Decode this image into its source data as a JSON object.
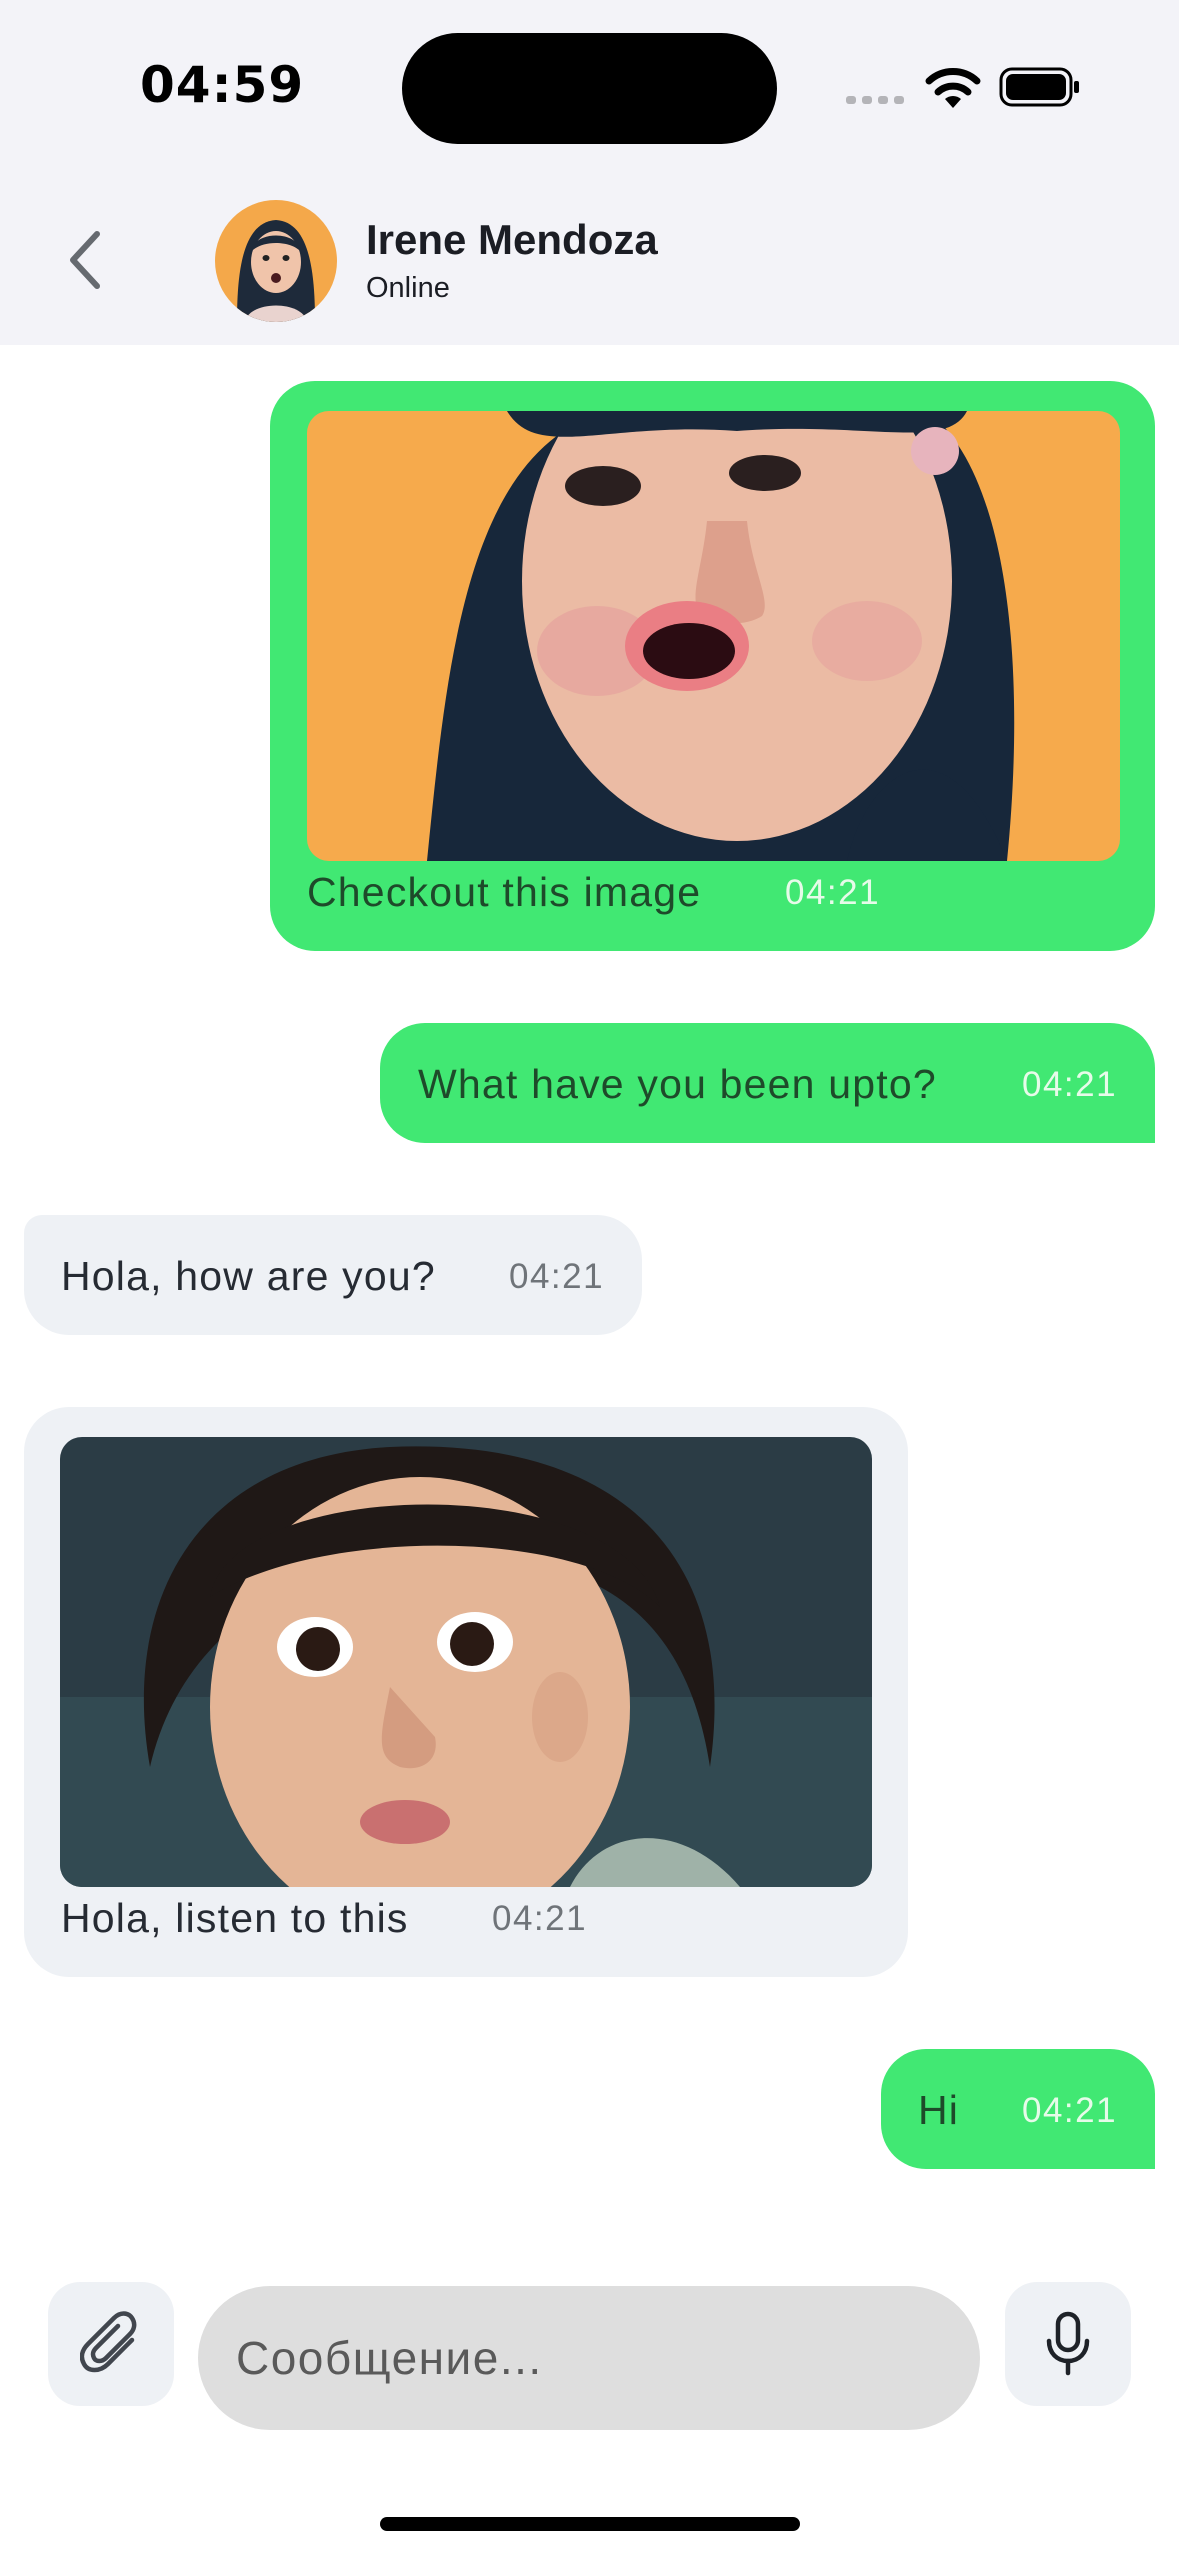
{
  "status_bar": {
    "time": "04:59"
  },
  "header": {
    "contact_name": "Irene Mendoza",
    "contact_status": "Online",
    "avatar": "girl-portrait"
  },
  "messages": [
    {
      "direction": "outgoing",
      "type": "image",
      "image": "girl-surprised-photo",
      "text": "Checkout this image",
      "time": "04:21"
    },
    {
      "direction": "outgoing",
      "type": "text",
      "text": "What have you been upto?",
      "time": "04:21"
    },
    {
      "direction": "incoming",
      "type": "text",
      "text": "Hola, how are you?",
      "time": "04:21"
    },
    {
      "direction": "incoming",
      "type": "image",
      "image": "toddler-curly-hair-photo",
      "text": "Hola, listen to this",
      "time": "04:21"
    },
    {
      "direction": "outgoing",
      "type": "text",
      "text": "Hi",
      "time": "04:21"
    }
  ],
  "composer": {
    "placeholder": "Сообщение...",
    "attach_icon": "paperclip-icon",
    "mic_icon": "microphone-icon"
  },
  "colors": {
    "outgoing_bubble": "#41e873",
    "incoming_bubble": "#eef1f5",
    "header_background": "#f3f3f8",
    "input_background": "#dedede"
  }
}
